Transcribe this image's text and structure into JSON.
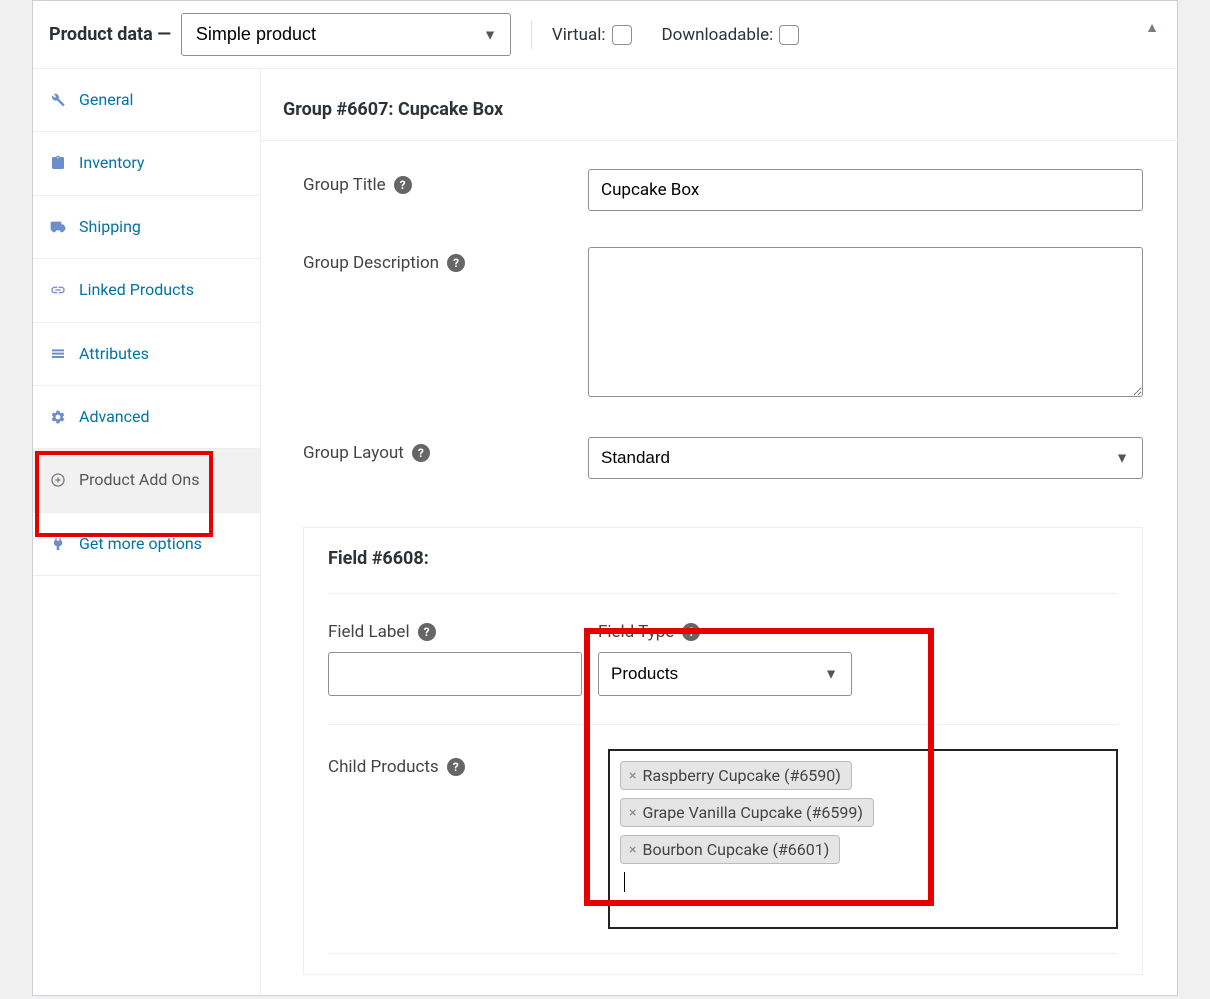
{
  "header": {
    "title_prefix": "Product data —",
    "product_type": "Simple product",
    "virtual_label": "Virtual:",
    "downloadable_label": "Downloadable:"
  },
  "sidebar": {
    "items": [
      {
        "label": "General"
      },
      {
        "label": "Inventory"
      },
      {
        "label": "Shipping"
      },
      {
        "label": "Linked Products"
      },
      {
        "label": "Attributes"
      },
      {
        "label": "Advanced"
      },
      {
        "label": "Product Add Ons"
      },
      {
        "label": "Get more options"
      }
    ]
  },
  "group": {
    "heading": "Group #6607: Cupcake Box",
    "title_label": "Group Title",
    "title_value": "Cupcake Box",
    "desc_label": "Group Description",
    "desc_value": "",
    "layout_label": "Group Layout",
    "layout_value": "Standard"
  },
  "field": {
    "heading": "Field #6608:",
    "label_label": "Field Label",
    "label_value": "",
    "type_label": "Field Type",
    "type_value": "Products",
    "child_label": "Child Products",
    "child_products": [
      "Raspberry Cupcake (#6590)",
      "Grape Vanilla Cupcake (#6599)",
      "Bourbon Cupcake (#6601)"
    ]
  }
}
